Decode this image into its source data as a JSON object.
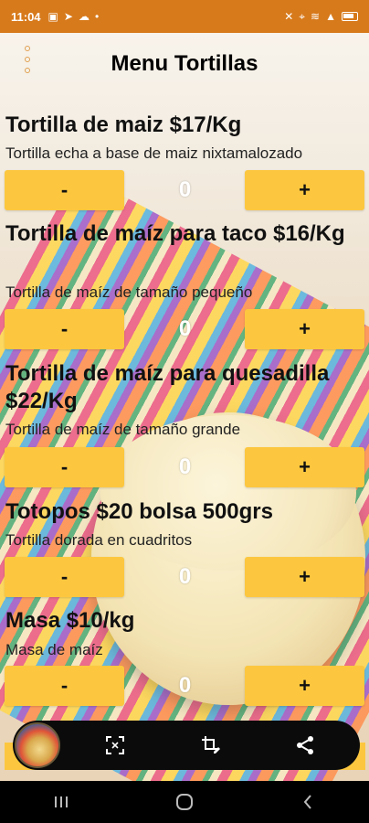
{
  "status_bar": {
    "time": "11:04"
  },
  "header": {
    "title": "Menu Tortillas"
  },
  "products": [
    {
      "name": "Tortilla de maiz  $17/Kg",
      "description": "Tortilla echa a base de maiz nixtamalozado",
      "quantity": "0",
      "minus_label": "-",
      "plus_label": "+"
    },
    {
      "name": "Tortilla de maíz para taco  $16/Kg",
      "description": "Tortilla de maíz de tamaño pequeño",
      "quantity": "0",
      "minus_label": "-",
      "plus_label": "+"
    },
    {
      "name": "Tortilla de maíz para quesadilla $22/Kg",
      "description": "Tortilla de maíz de tamaño grande",
      "quantity": "0",
      "minus_label": "-",
      "plus_label": "+"
    },
    {
      "name": "Totopos $20 bolsa 500grs",
      "description": "Tortilla dorada en cuadritos",
      "quantity": "0",
      "minus_label": "-",
      "plus_label": "+"
    },
    {
      "name": "Masa  $10/kg",
      "description": "Masa de maíz",
      "quantity": "0",
      "minus_label": "-",
      "plus_label": "+"
    }
  ],
  "colors": {
    "status_bar": "#d77a1c",
    "button": "#fcc73f",
    "action_bar": "#0b0b0b"
  },
  "icons": {
    "action_bar": [
      "screenshot-icon",
      "edit-crop-icon",
      "share-icon"
    ],
    "nav": [
      "recent-apps-icon",
      "home-icon",
      "back-icon"
    ]
  }
}
